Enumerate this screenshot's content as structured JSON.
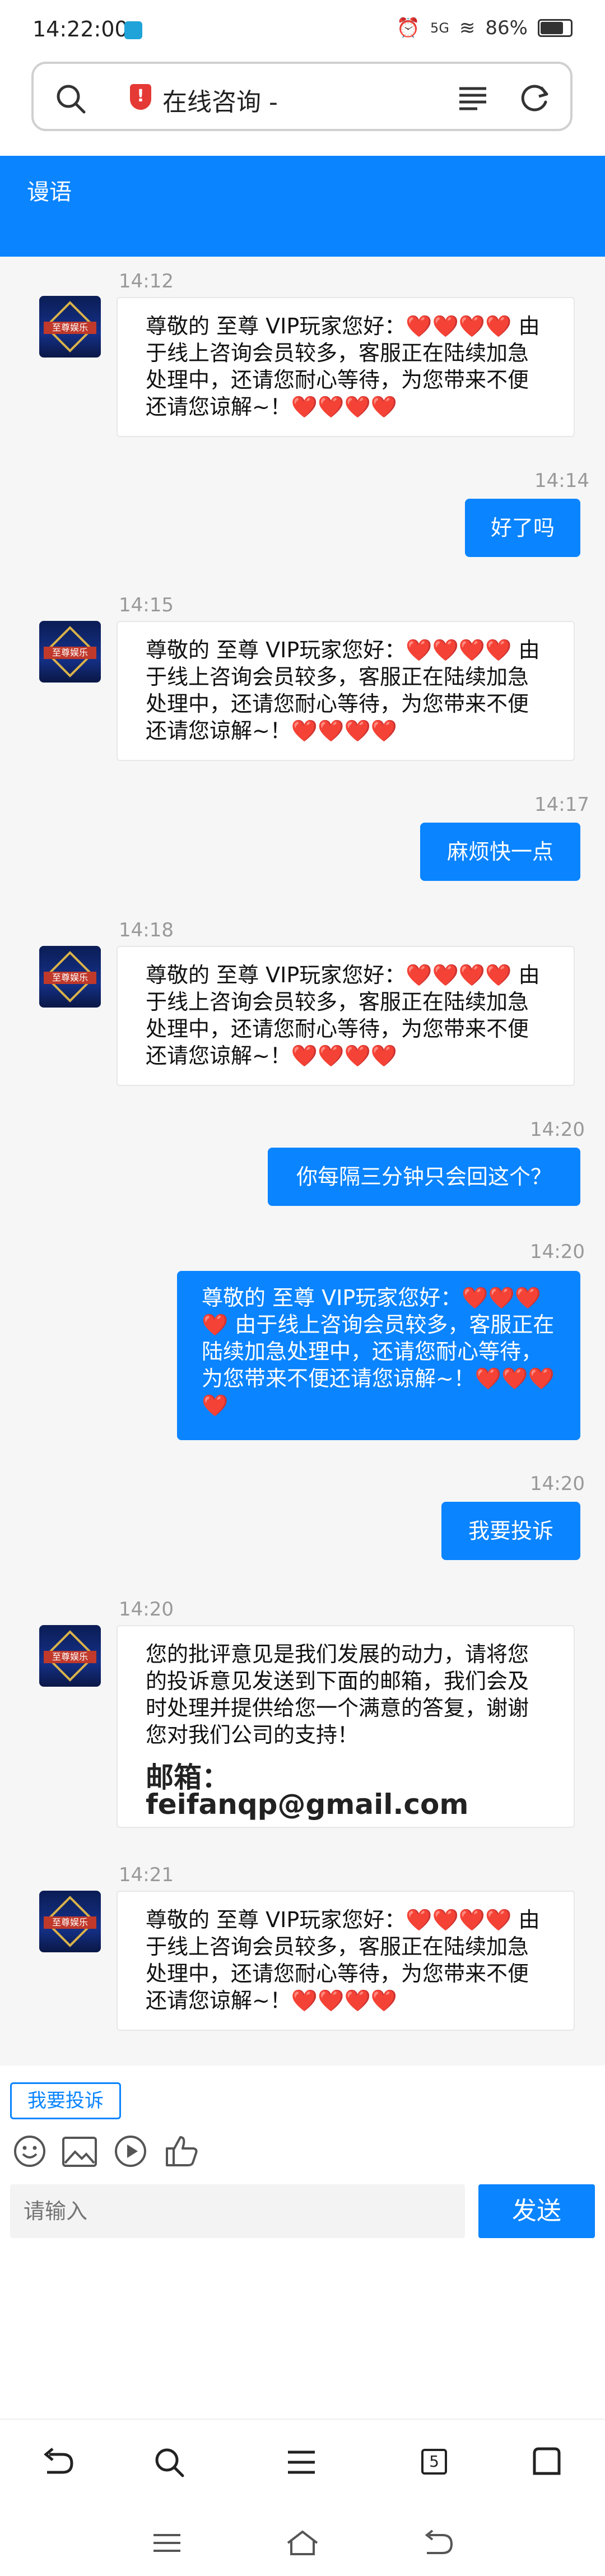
{
  "status_bar": {
    "time": "14:22:00",
    "network": "5G",
    "battery_text": "86%",
    "battery_level": 0.86
  },
  "url_bar": {
    "title": "在线咨询 -"
  },
  "header": {
    "title": "谩语"
  },
  "messages": [
    {
      "time": "14:12",
      "text": "尊敬的 至尊 VIP玩家您好：❤️❤️❤️❤️ 由于线上咨询会员较多，客服正在陆续加急处理中，还请您耐心等待，为您带来不便还请您谅解~！❤️❤️❤️❤️"
    },
    {
      "time": "14:14",
      "text": "好了吗"
    },
    {
      "time": "14:15",
      "text": "尊敬的 至尊 VIP玩家您好：❤️❤️❤️❤️ 由于线上咨询会员较多，客服正在陆续加急处理中，还请您耐心等待，为您带来不便还请您谅解~！❤️❤️❤️❤️"
    },
    {
      "time": "14:17",
      "text": "麻烦快一点"
    },
    {
      "time": "14:18",
      "text": "尊敬的 至尊 VIP玩家您好：❤️❤️❤️❤️ 由于线上咨询会员较多，客服正在陆续加急处理中，还请您耐心等待，为您带来不便还请您谅解~！❤️❤️❤️❤️"
    },
    {
      "time": "14:20",
      "text": "你每隔三分钟只会回这个？"
    },
    {
      "time": "14:20",
      "text": "尊敬的 至尊 VIP玩家您好：❤️❤️❤️❤️ 由于线上咨询会员较多，客服正在陆续加急处理中，还请您耐心等待，为您带来不便还请您谅解~！❤️❤️❤️❤️"
    },
    {
      "time": "14:20",
      "text": "我要投诉"
    },
    {
      "time": "14:20",
      "text": "您的批评意见是我们发展的动力，请将您的投诉意见发送到下面的邮箱，我们会及时处理并提供给您一个满意的答复，谢谢您对我们公司的支持！",
      "email": "邮箱：feifanqp@gmail.com"
    },
    {
      "time": "14:21",
      "text": "尊敬的 至尊 VIP玩家您好：❤️❤️❤️❤️ 由于线上咨询会员较多，客服正在陆续加急处理中，还请您耐心等待，为您带来不便还请您谅解~！❤️❤️❤️❤️"
    }
  ],
  "avatar_label": "至尊娱乐",
  "quick_reply": "我要投诉",
  "toolbar_icons": [
    "emoji-icon",
    "image-icon",
    "video-icon",
    "thumbs-up-icon"
  ],
  "input": {
    "placeholder": "请输入",
    "send_label": "发送"
  },
  "browser_nav": {
    "tabs_count": "5"
  },
  "colors": {
    "accent": "#0a84ff",
    "bubble_in": "#ffffff",
    "chat_bg": "#f6f6f6"
  }
}
